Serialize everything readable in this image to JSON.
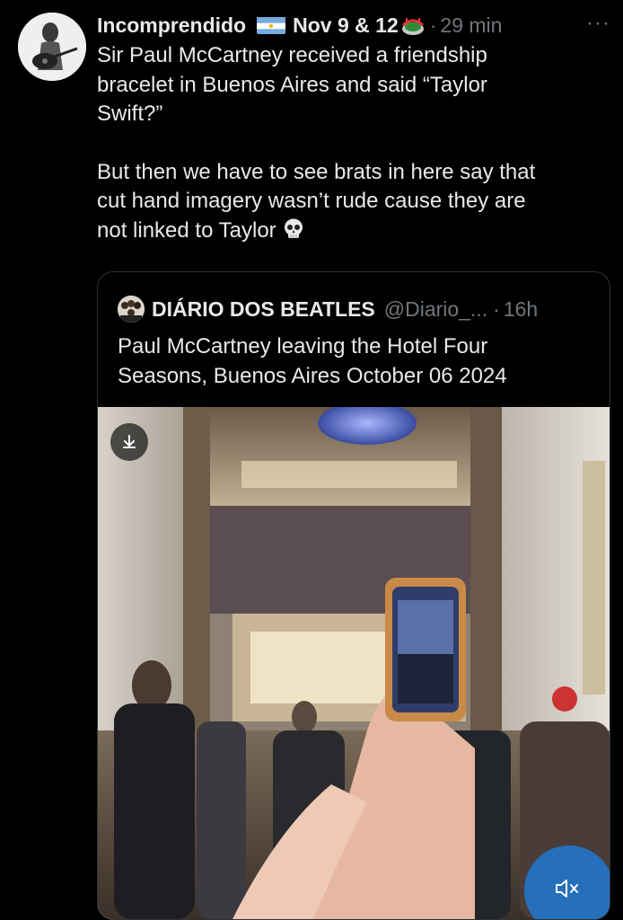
{
  "tweet": {
    "author_name": "Incomprendido",
    "handle": "Nov 9 & 12",
    "separator": "·",
    "time": "29 min",
    "more_label": "···",
    "body_paragraph_1": "Sir Paul McCartney received a friendship\nbracelet in Buenos Aires and said “Taylor\nSwift?”",
    "body_paragraph_2": "But then we have to see brats in here say that\ncut hand imagery wasn’t rude cause they are\nnot linked to Taylor"
  },
  "quoted_tweet": {
    "author_name": "DIÁRIO DOS BEATLES",
    "handle": "@Diario_...",
    "separator": "·",
    "time": "16h",
    "text": "Paul McCartney leaving the Hotel Four\nSeasons, Buenos Aires October 06 2024"
  },
  "icons": {
    "flag": "argentina-flag-icon",
    "stadium": "stadium-icon",
    "skull": "skull-emoji-icon",
    "download": "download-icon",
    "mute": "volume-muted-icon"
  },
  "colors": {
    "background": "#000000",
    "text_primary": "#e7e9ea",
    "text_secondary": "#71767b",
    "border": "#2f3336",
    "mute_button": "#1e78d2"
  }
}
